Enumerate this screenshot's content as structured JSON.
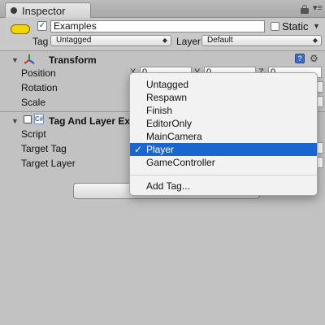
{
  "tab": {
    "label": "Inspector",
    "icon": "inspector-icon"
  },
  "header": {
    "active_checked": true,
    "object_name": "Examples",
    "static_label": "Static",
    "static_checked": false,
    "tag_label": "Tag",
    "tag_value": "Untagged",
    "layer_label": "Layer",
    "layer_value": "Default"
  },
  "transform": {
    "title": "Transform",
    "properties": [
      {
        "label": "Position",
        "x": "0",
        "y": "0",
        "z": "0"
      },
      {
        "label": "Rotation"
      },
      {
        "label": "Scale"
      }
    ],
    "axis_labels": [
      "X",
      "Y",
      "Z"
    ]
  },
  "script_component": {
    "title": "Tag And Layer Ex",
    "rows": [
      {
        "label": "Script"
      },
      {
        "label": "Target Tag"
      },
      {
        "label": "Target Layer"
      }
    ]
  },
  "popup": {
    "items": [
      {
        "label": "Untagged",
        "selected": false
      },
      {
        "label": "Respawn",
        "selected": false
      },
      {
        "label": "Finish",
        "selected": false
      },
      {
        "label": "EditorOnly",
        "selected": false
      },
      {
        "label": "MainCamera",
        "selected": false
      },
      {
        "label": "Player",
        "selected": true
      },
      {
        "label": "GameController",
        "selected": false
      }
    ],
    "add_label": "Add Tag...",
    "check_glyph": "✓"
  },
  "colors": {
    "selection": "#1a66cf",
    "gameobject_icon": "#f2d600",
    "panel_bg": "#c2c2c2"
  }
}
